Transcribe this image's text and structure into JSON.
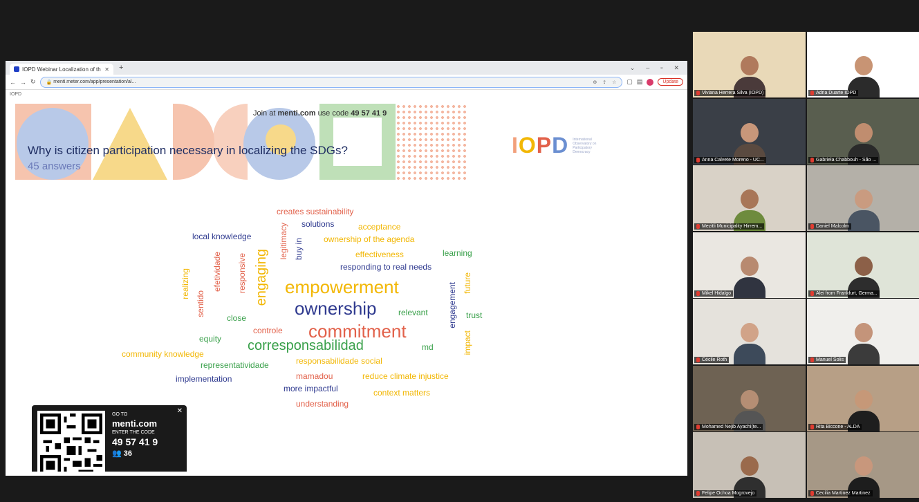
{
  "browser": {
    "tab_title": "IOPD Webinar Localization of th",
    "url": "menti.meter.com/app/presentation/al...",
    "update_label": "Update",
    "bookmark": "IOPD"
  },
  "slide": {
    "join_prefix": "Join at",
    "join_site": "menti.com",
    "join_use": "use code",
    "join_code": "49 57 41 9",
    "title": "Why is citizen participation necessary in localizing the SDGs?",
    "answers": "45 answers",
    "logo_text": "IOPD",
    "logo_desc": "International Observatory on Participatory Democracy"
  },
  "words": [
    {
      "text": "creates sustainability",
      "color": "#e2614a",
      "size": 12
    },
    {
      "text": "solutions",
      "color": "#2f3a8f",
      "size": 12
    },
    {
      "text": "acceptance",
      "color": "#f2b705",
      "size": 12
    },
    {
      "text": "local knowledge",
      "color": "#2f3a8f",
      "size": 12
    },
    {
      "text": "ownership of the agenda",
      "color": "#f2b705",
      "size": 12
    },
    {
      "text": "effectiveness",
      "color": "#f2b705",
      "size": 12
    },
    {
      "text": "learning",
      "color": "#39a04a",
      "size": 12
    },
    {
      "text": "responding to real needs",
      "color": "#2f3a8f",
      "size": 12
    },
    {
      "text": "empowerment",
      "color": "#f2b705",
      "size": 26
    },
    {
      "text": "ownership",
      "color": "#2f3a8f",
      "size": 26
    },
    {
      "text": "relevant",
      "color": "#39a04a",
      "size": 12
    },
    {
      "text": "trust",
      "color": "#39a04a",
      "size": 12
    },
    {
      "text": "close",
      "color": "#39a04a",
      "size": 12
    },
    {
      "text": "commitment",
      "color": "#e2614a",
      "size": 26
    },
    {
      "text": "controle",
      "color": "#e2614a",
      "size": 12
    },
    {
      "text": "equity",
      "color": "#39a04a",
      "size": 12
    },
    {
      "text": "corresponsabilidad",
      "color": "#39a04a",
      "size": 20
    },
    {
      "text": "md",
      "color": "#39a04a",
      "size": 12
    },
    {
      "text": "community knowledge",
      "color": "#f2b705",
      "size": 12
    },
    {
      "text": "responsabilidade social",
      "color": "#f2b705",
      "size": 12
    },
    {
      "text": "representatividade",
      "color": "#39a04a",
      "size": 12
    },
    {
      "text": "implementation",
      "color": "#2f3a8f",
      "size": 12
    },
    {
      "text": "mamadou",
      "color": "#e2614a",
      "size": 12
    },
    {
      "text": "reduce climate injustice",
      "color": "#f2b705",
      "size": 12
    },
    {
      "text": "more impactful",
      "color": "#2f3a8f",
      "size": 12
    },
    {
      "text": "context matters",
      "color": "#f2b705",
      "size": 12
    },
    {
      "text": "understanding",
      "color": "#e2614a",
      "size": 12
    },
    {
      "text": "legitimacy",
      "color": "#e2614a",
      "size": 12
    },
    {
      "text": "buy in",
      "color": "#2f3a8f",
      "size": 12
    },
    {
      "text": "engaging",
      "color": "#f2b705",
      "size": 20
    },
    {
      "text": "responsive",
      "color": "#e2614a",
      "size": 12
    },
    {
      "text": "efetividade",
      "color": "#e2614a",
      "size": 12
    },
    {
      "text": "sentido",
      "color": "#e2614a",
      "size": 12
    },
    {
      "text": "realizing",
      "color": "#f2b705",
      "size": 12
    },
    {
      "text": "engagement",
      "color": "#2f3a8f",
      "size": 12
    },
    {
      "text": "future",
      "color": "#f2b705",
      "size": 12
    },
    {
      "text": "impact",
      "color": "#f2b705",
      "size": 12
    }
  ],
  "qr": {
    "goto": "GO TO",
    "site": "menti.com",
    "enter": "ENTER THE CODE",
    "code": "49 57 41 9",
    "participants": "36"
  },
  "participants": [
    {
      "name": "Viviana Herrera Silva (IOPD)",
      "bg": "#e9d9b8",
      "skin": "#b07a5c",
      "shirt": "#4a3a3a",
      "active": true
    },
    {
      "name": "Adria Duarte IOPD",
      "bg": "#ffffff",
      "skin": "#c89474",
      "shirt": "#2b2b2b",
      "active": false
    },
    {
      "name": "Anna Calvete Moreno - UC...",
      "bg": "#3a3f47",
      "skin": "#c8977a",
      "shirt": "#5a4a40",
      "active": false
    },
    {
      "name": "Gabriela Chabbouh - São ...",
      "bg": "#595e4f",
      "skin": "#c08d6f",
      "shirt": "#2a2a2a",
      "active": false
    },
    {
      "name": "Mezitli Municipality Hirrem...",
      "bg": "#d9d2c7",
      "skin": "#a87658",
      "shirt": "#6e8b3d",
      "active": false
    },
    {
      "name": "Daniel Malcolm",
      "bg": "#b4b0a8",
      "skin": "#c99b80",
      "shirt": "#4a5563",
      "active": false
    },
    {
      "name": "Mikel Hidalgo",
      "bg": "#eae7e1",
      "skin": "#b88a70",
      "shirt": "#303440",
      "active": false
    },
    {
      "name": "Alei from Frankfurt, Germa...",
      "bg": "#dfe4d8",
      "skin": "#8c6048",
      "shirt": "#2d2d2d",
      "active": false
    },
    {
      "name": "Cécile Roth",
      "bg": "#e5e2dc",
      "skin": "#d1a388",
      "shirt": "#3d4a5a",
      "active": false
    },
    {
      "name": "Manuel Solis",
      "bg": "#f0efec",
      "skin": "#c4947a",
      "shirt": "#3b3b3b",
      "active": false
    },
    {
      "name": "Mohamed Nejib Ayachi(te...",
      "bg": "#6e6253",
      "skin": "#b58e74",
      "shirt": "#555555",
      "active": false
    },
    {
      "name": "Rita Biccone - ALDA",
      "bg": "#b79f86",
      "skin": "#c69878",
      "shirt": "#1e1e1e",
      "active": false
    },
    {
      "name": "Felipe Ochoa Mogrovejo",
      "bg": "#c7c0b6",
      "skin": "#9a6a4c",
      "shirt": "#2f2f2f",
      "active": false
    },
    {
      "name": "Cecilia Martinez Martinez",
      "bg": "#a69886",
      "skin": "#c8977c",
      "shirt": "#1d1d1d",
      "active": false
    }
  ]
}
